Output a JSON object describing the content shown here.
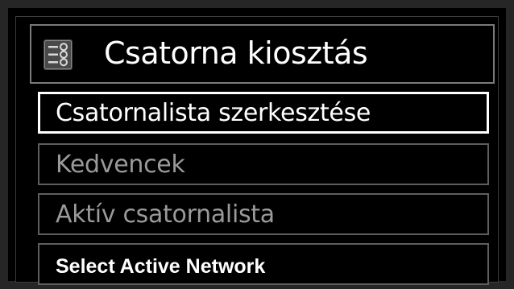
{
  "header": {
    "title": "Csatorna kiosztás",
    "icon": "channel-list-icon"
  },
  "menu": {
    "items": [
      {
        "label": "Csatornalista szerkesztése",
        "state": "selected"
      },
      {
        "label": "Kedvencek",
        "state": "normal"
      },
      {
        "label": "Aktív csatornalista",
        "state": "normal"
      },
      {
        "label": "Select Active Network",
        "state": "normal"
      }
    ]
  },
  "colors": {
    "background": "#000000",
    "selected_text": "#ffffff",
    "normal_text": "#9a9a9a",
    "border_normal": "#5e5e5e",
    "border_selected": "#ffffff"
  }
}
